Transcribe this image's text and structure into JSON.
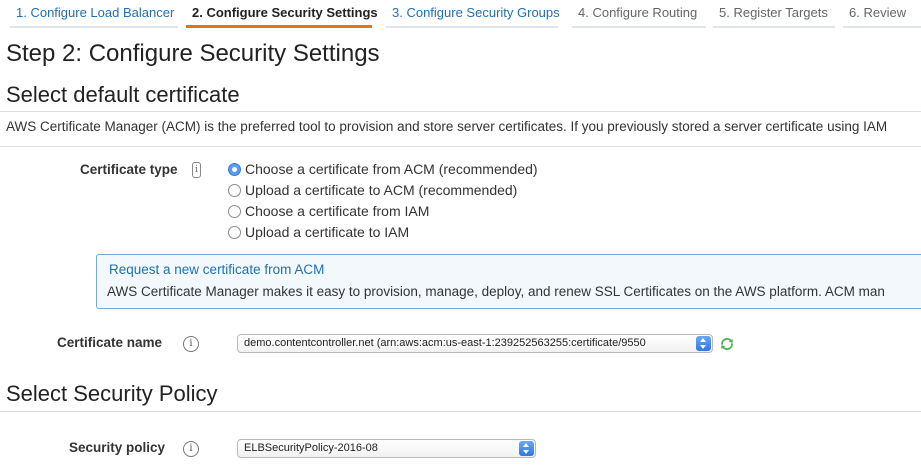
{
  "wizard": {
    "steps": [
      {
        "label": "1. Configure Load Balancer",
        "state": "done"
      },
      {
        "label": "2. Configure Security Settings",
        "state": "active"
      },
      {
        "label": "3. Configure Security Groups",
        "state": "link"
      },
      {
        "label": "4. Configure Routing",
        "state": "todo"
      },
      {
        "label": "5. Register Targets",
        "state": "todo"
      },
      {
        "label": "6. Review",
        "state": "todo"
      }
    ]
  },
  "page": {
    "title": "Step 2: Configure Security Settings"
  },
  "certificate_section": {
    "heading": "Select default certificate",
    "description": "AWS Certificate Manager (ACM) is the preferred tool to provision and store server certificates. If you previously stored a server certificate using IAM",
    "type_label": "Certificate type",
    "type_info_glyph": "i",
    "options": [
      {
        "label": "Choose a certificate from ACM (recommended)",
        "checked": true
      },
      {
        "label": "Upload a certificate to ACM (recommended)",
        "checked": false
      },
      {
        "label": "Choose a certificate from IAM",
        "checked": false
      },
      {
        "label": "Upload a certificate to IAM",
        "checked": false
      }
    ],
    "callout": {
      "link": "Request a new certificate from ACM",
      "text": "AWS Certificate Manager makes it easy to provision, manage, deploy, and renew SSL Certificates on the AWS platform. ACM man"
    },
    "name_label": "Certificate name",
    "name_info_glyph": "i",
    "name_value": "demo.contentcontroller.net (arn:aws:acm:us-east-1:239252563255:certificate/9550",
    "refresh_icon": "refresh-icon"
  },
  "policy_section": {
    "heading": "Select Security Policy",
    "policy_label": "Security policy",
    "policy_info_glyph": "i",
    "policy_value": "ELBSecurityPolicy-2016-08"
  },
  "colors": {
    "link": "#1f6fb5",
    "active_tab_underline": "#ec7211",
    "callout_border": "#7aa7d6",
    "select_arrow": "#2f78e0",
    "refresh": "#4caf50"
  }
}
